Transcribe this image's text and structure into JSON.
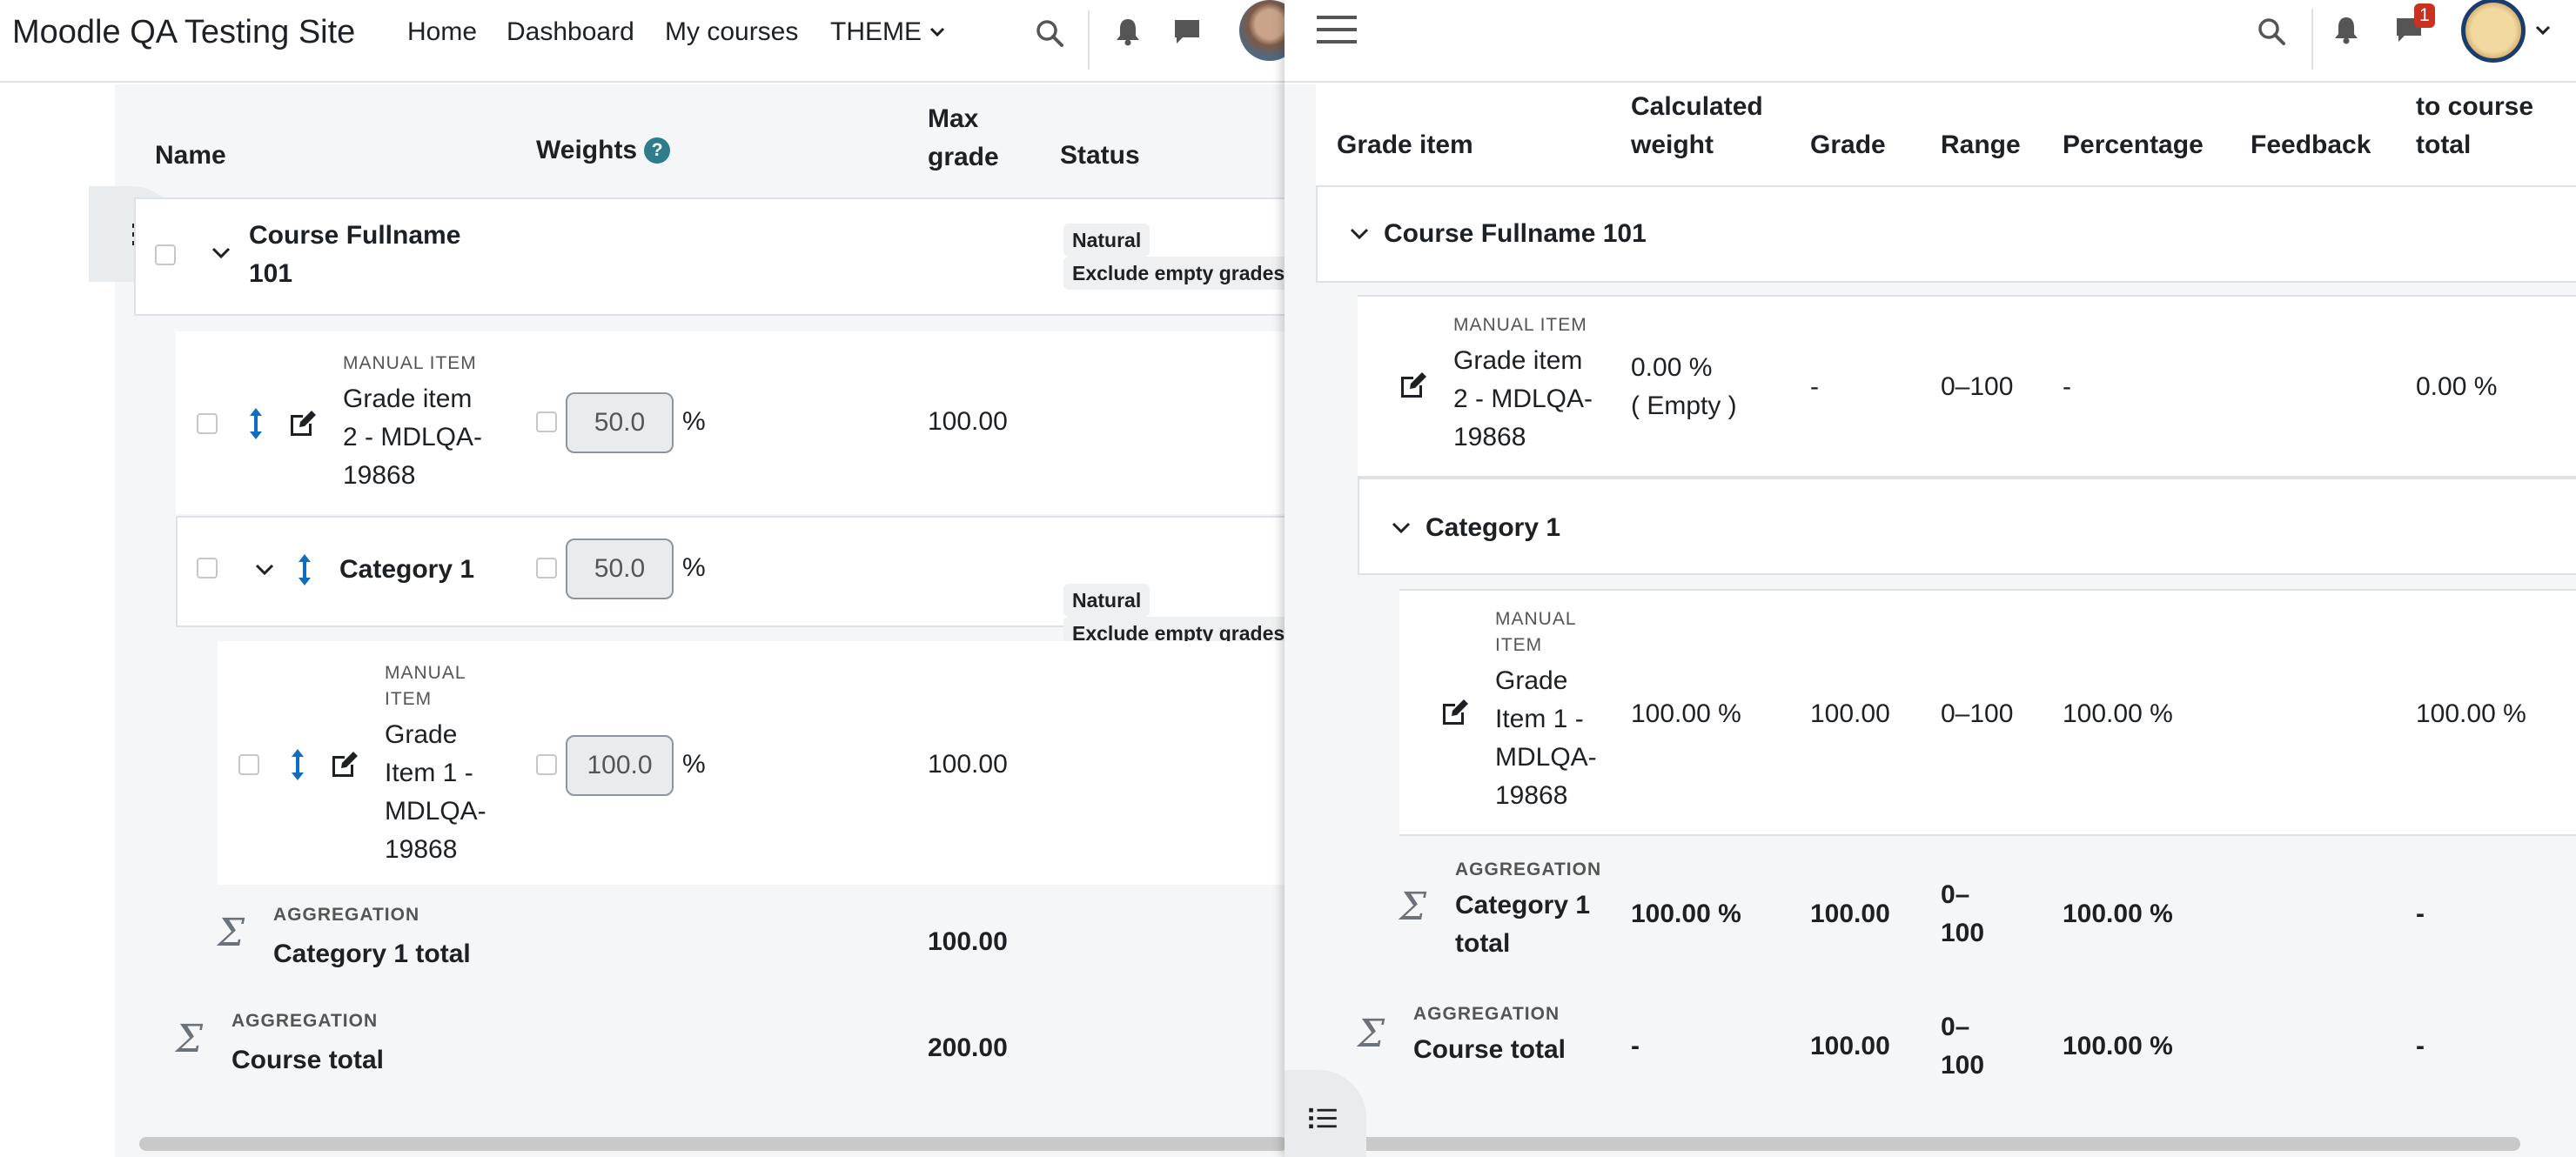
{
  "left": {
    "navbar": {
      "site_name": "Moodle QA Testing Site",
      "links": [
        "Home",
        "Dashboard",
        "My courses",
        "THEME"
      ]
    },
    "table": {
      "headers": {
        "name": "Name",
        "weights": "Weights",
        "max_grade_line1": "Max",
        "max_grade_line2": "grade",
        "status": "Status"
      },
      "course": {
        "name_line1": "Course Fullname",
        "name_line2": "101",
        "status1": "Natural",
        "status2": "Exclude empty grades"
      },
      "item2": {
        "type": "MANUAL ITEM",
        "name_line1": "Grade item",
        "name_line2": "2 - MDLQA-",
        "name_line3": "19868",
        "weight": "50.0",
        "unit": "%",
        "max_grade": "100.00"
      },
      "category": {
        "name": "Category 1",
        "weight": "50.0",
        "unit": "%",
        "status1": "Natural",
        "status2": "Exclude empty grades"
      },
      "item1": {
        "type_line1": "MANUAL",
        "type_line2": "ITEM",
        "name_line1": "Grade",
        "name_line2": "Item 1 -",
        "name_line3": "MDLQA-",
        "name_line4": "19868",
        "weight": "100.0",
        "unit": "%",
        "max_grade": "100.00"
      },
      "category_total": {
        "type": "AGGREGATION",
        "name": "Category 1 total",
        "max_grade": "100.00"
      },
      "course_total": {
        "type": "AGGREGATION",
        "name": "Course total",
        "max_grade": "200.00"
      }
    }
  },
  "right": {
    "notification_count": "1",
    "table": {
      "headers": {
        "grade_item": "Grade item",
        "calc_weight_line1": "Calculated",
        "calc_weight_line2": "weight",
        "grade": "Grade",
        "range": "Range",
        "percentage": "Percentage",
        "feedback": "Feedback",
        "contrib_line1": "to course",
        "contrib_line2": "total"
      },
      "course": {
        "name": "Course Fullname 101"
      },
      "item2": {
        "type": "MANUAL ITEM",
        "name_line1": "Grade item",
        "name_line2": "2 - MDLQA-",
        "name_line3": "19868",
        "weight_line1": "0.00 %",
        "weight_line2": "( Empty )",
        "grade": "-",
        "range": "0–100",
        "percentage": "-",
        "contrib": "0.00 %"
      },
      "category": {
        "name": "Category 1"
      },
      "item1": {
        "type_line1": "MANUAL",
        "type_line2": "ITEM",
        "name_line1": "Grade",
        "name_line2": "Item 1 -",
        "name_line3": "MDLQA-",
        "name_line4": "19868",
        "weight": "100.00 %",
        "grade": "100.00",
        "range": "0–100",
        "percentage": "100.00 %",
        "contrib": "100.00 %"
      },
      "category_total": {
        "type": "AGGREGATION",
        "name_line1": "Category 1",
        "name_line2": "total",
        "weight": "100.00 %",
        "grade": "100.00",
        "range_line1": "0–",
        "range_line2": "100",
        "percentage": "100.00 %",
        "contrib": "-"
      },
      "course_total": {
        "type": "AGGREGATION",
        "name": "Course total",
        "weight": "-",
        "grade": "100.00",
        "range_line1": "0–",
        "range_line2": "100",
        "percentage": "100.00 %",
        "contrib": "-"
      }
    }
  },
  "icons": {
    "search": "search-icon",
    "bell": "bell-icon",
    "chat": "chat-icon",
    "hamburger": "hamburger-icon",
    "list": "list-icon",
    "move": "move-icon",
    "edit": "edit-icon",
    "sigma": "sigma-icon",
    "help": "help-icon",
    "chevron": "chevron-down-icon"
  },
  "colors": {
    "accent": "#0f6cbf",
    "help_badge": "#2d7e8a",
    "notification_badge": "#ca3120",
    "avatar_ring": "#1a3d6e"
  }
}
